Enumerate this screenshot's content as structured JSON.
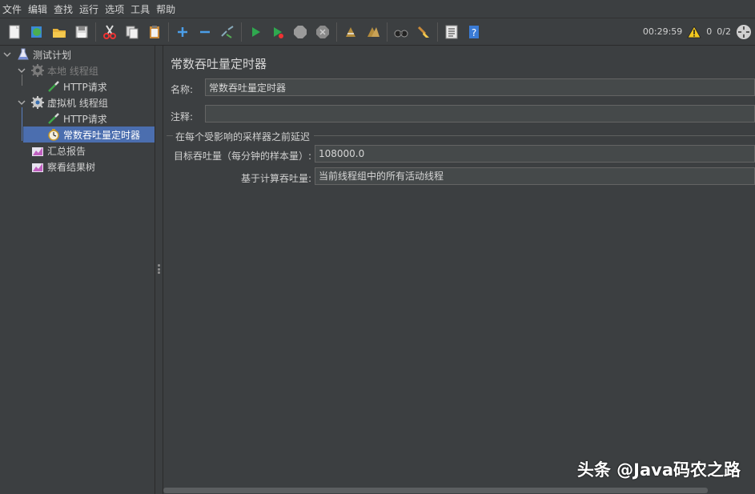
{
  "menu": [
    "文件",
    "编辑",
    "查找",
    "运行",
    "选项",
    "工具",
    "帮助"
  ],
  "toolbar": {
    "icons": [
      "new-icon",
      "templates-icon",
      "open-icon",
      "save-icon",
      "cut-icon",
      "copy-icon",
      "paste-icon",
      "expand-icon",
      "collapse-icon",
      "toggle-icon",
      "start-icon",
      "start-no-pause-icon",
      "stop-icon",
      "shutdown-icon",
      "clear-icon",
      "clear-all-icon",
      "search-icon",
      "reset-search-icon",
      "function-helper-icon",
      "help-icon"
    ],
    "elapsed_time": "00:29:59",
    "warning_count": "0",
    "threads": "0/2"
  },
  "tree": {
    "nodes": [
      {
        "label": "测试计划",
        "icon": "test-plan-icon",
        "state": "normal"
      },
      {
        "label": "本地 线程组",
        "icon": "gear-icon",
        "state": "disabled"
      },
      {
        "label": "HTTP请求",
        "icon": "pipette-icon",
        "state": "normal"
      },
      {
        "label": "虚拟机 线程组",
        "icon": "gear-icon",
        "state": "normal"
      },
      {
        "label": "HTTP请求",
        "icon": "pipette-icon",
        "state": "normal"
      },
      {
        "label": "常数吞吐量定时器",
        "icon": "timer-icon",
        "state": "selected"
      },
      {
        "label": "汇总报告",
        "icon": "chart-icon",
        "state": "normal"
      },
      {
        "label": "察看结果树",
        "icon": "chart-icon",
        "state": "normal"
      }
    ]
  },
  "panel": {
    "title": "常数吞吐量定时器",
    "name_label": "名称:",
    "name_value": "常数吞吐量定时器",
    "comment_label": "注释:",
    "comment_value": "",
    "group_title": "在每个受影响的采样器之前延迟",
    "target_label": "目标吞吐量（每分钟的样本量）:",
    "target_value": "108000.0",
    "calc_label": "基于计算吞吐量:",
    "calc_value": "当前线程组中的所有活动线程"
  },
  "watermark": "头条 @Java码农之路",
  "colors": {
    "background": "#3c3f41",
    "selected": "#4b6eaf",
    "field": "#45494a"
  }
}
